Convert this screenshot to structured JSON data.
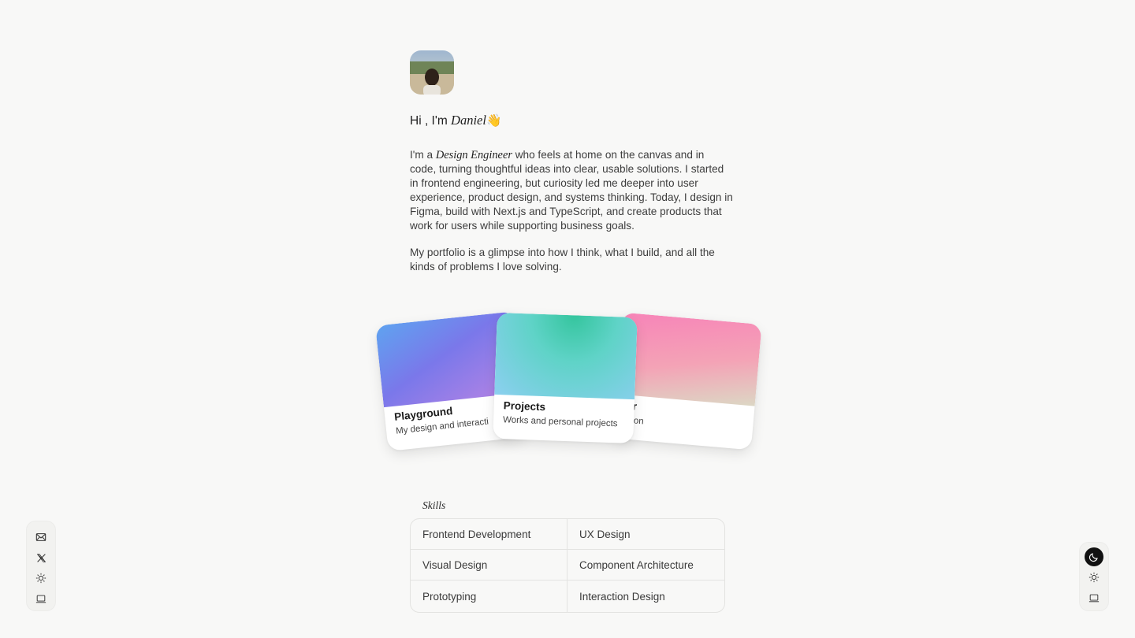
{
  "profile": {
    "greeting_prefix": "Hi , I'm",
    "name": "Daniel",
    "wave": "👋"
  },
  "bio": {
    "p1_before": "I'm a ",
    "p1_role": "Design Engineer",
    "p1_after": " who feels at home on the canvas and in code, turning thoughtful ideas into clear, usable solutions.  I started in frontend engineering, but curiosity led me deeper into user experience, product design, and systems thinking. Today, I design in Figma, build with Next.js and TypeScript, and create products that work for users while supporting business goals.",
    "p2": "My portfolio is a glimpse into how I think, what I build, and all the kinds of problems I love solving."
  },
  "cards": {
    "left": {
      "title": "Playground",
      "desc": "My design and interacti"
    },
    "middle": {
      "title": "Projects",
      "desc": "Works and personal projects"
    },
    "right": {
      "title": "der",
      "desc": "ription"
    }
  },
  "skills": {
    "label": "Skills",
    "items": [
      "Frontend Development",
      "UX Design",
      "Visual Design",
      "Component Architecture",
      "Prototyping",
      "Interaction Design"
    ]
  },
  "dock_left": {
    "icons": [
      "mail-icon",
      "x-icon",
      "sun-icon",
      "laptop-icon"
    ]
  },
  "dock_right": {
    "icons": [
      "moon-icon",
      "sun-icon",
      "laptop-icon"
    ],
    "active": "moon-icon"
  }
}
